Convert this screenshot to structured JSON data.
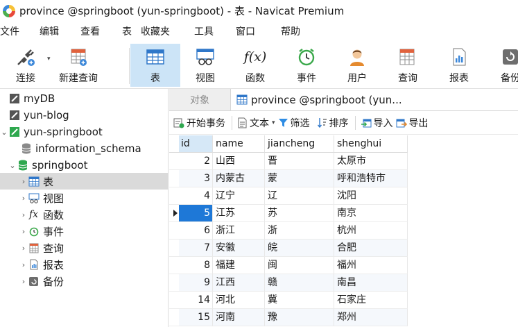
{
  "window": {
    "title": "province @springboot (yun-springboot) - 表 - Navicat Premium"
  },
  "menu": [
    "文件",
    "编辑",
    "查看",
    "表",
    "收藏夹",
    "工具",
    "窗口",
    "帮助"
  ],
  "toolbar": {
    "connect": "连接",
    "new_query": "新建查询",
    "table": "表",
    "view": "视图",
    "function": "函数",
    "event": "事件",
    "user": "用户",
    "query": "查询",
    "report": "报表",
    "backup": "备份",
    "function_glyph": "f(x)"
  },
  "tree": {
    "conn1": "myDB",
    "conn2": "yun-blog",
    "conn3": "yun-springboot",
    "db1": "information_schema",
    "db2": "springboot",
    "items": [
      "表",
      "视图",
      "函数",
      "事件",
      "查询",
      "报表",
      "备份"
    ],
    "fx_glyph": "fx"
  },
  "tabs": {
    "objects": "对象",
    "doc": "province @springboot (yun..."
  },
  "subtoolbar": {
    "begin_tx": "开始事务",
    "text": "文本",
    "filter": "筛选",
    "sort": "排序",
    "import": "导入",
    "export": "导出"
  },
  "grid": {
    "columns": [
      "id",
      "name",
      "jiancheng",
      "shenghui"
    ],
    "rows": [
      [
        "2",
        "山西",
        "晋",
        "太原市"
      ],
      [
        "3",
        "内蒙古",
        "蒙",
        "呼和浩特市"
      ],
      [
        "4",
        "辽宁",
        "辽",
        "沈阳"
      ],
      [
        "5",
        "江苏",
        "苏",
        "南京"
      ],
      [
        "6",
        "浙江",
        "浙",
        "杭州"
      ],
      [
        "7",
        "安徽",
        "皖",
        "合肥"
      ],
      [
        "8",
        "福建",
        "闽",
        "福州"
      ],
      [
        "9",
        "江西",
        "赣",
        "南昌"
      ],
      [
        "14",
        "河北",
        "冀",
        "石家庄"
      ],
      [
        "15",
        "河南",
        "豫",
        "郑州"
      ]
    ]
  },
  "colors": {
    "accent": "#1e78d7",
    "selected_tool": "#cce4f7",
    "db_green": "#2fa84f"
  }
}
